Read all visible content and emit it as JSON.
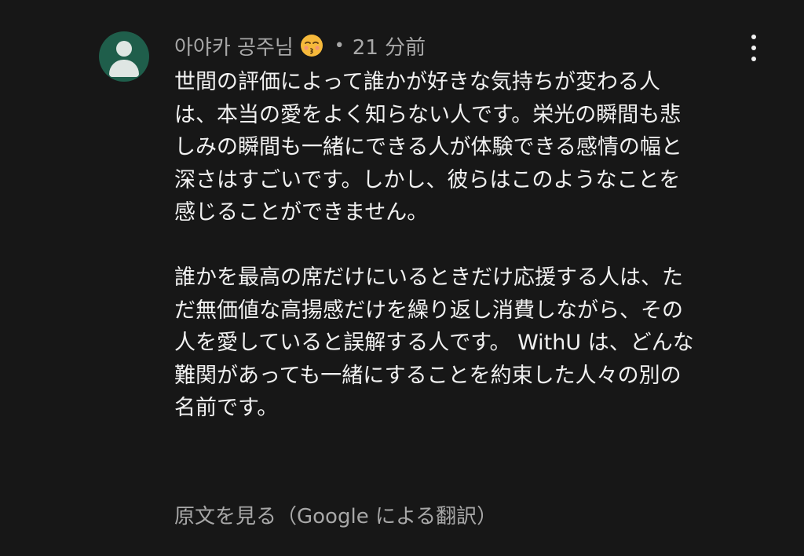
{
  "author": {
    "name": "아야카 공주님",
    "emoji": "kissing-face-with-closed-eyes-icon",
    "separator": "•",
    "time": "21 分前"
  },
  "comment": {
    "paragraph1": [
      "世間の評価によって誰かが好きな気持ちが変わる人",
      "は、本当の愛をよく知らない人です。栄光の瞬間も悲",
      "しみの瞬間も一緒にできる人が体験できる感情の幅と",
      "深さはすごいです。しかし、彼らはこのようなことを",
      "感じることができません。"
    ],
    "paragraph2": [
      "誰かを最高の席だけにいるときだけ応援する人は、た",
      "だ無価値な高揚感だけを繰り返し消費しながら、その",
      "人を愛していると誤解する人です。 WithU は、どんな",
      "難関があっても一緒にすることを約束した人々の別の",
      "名前です。"
    ]
  },
  "translate_label": "原文を見る（Google による翻訳）",
  "colors": {
    "background": "#171717",
    "text": "#f1f1f1",
    "secondary_text": "#a8a8a8",
    "avatar_bg": "#1f5e4b"
  }
}
